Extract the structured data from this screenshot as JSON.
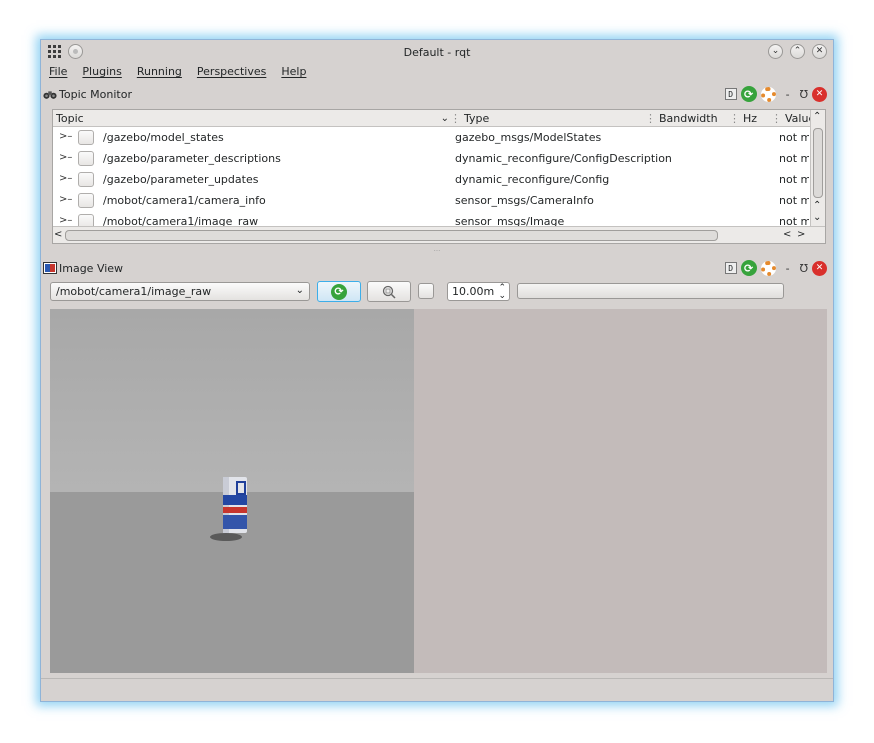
{
  "window": {
    "title": "Default - rqt"
  },
  "menubar": {
    "items": [
      "File",
      "Plugins",
      "Running",
      "Perspectives",
      "Help"
    ]
  },
  "topic_monitor": {
    "title": "Topic Monitor",
    "dock_buttons": {
      "debug_label": "D",
      "minimize_label": "-",
      "float_label": "Ʊ"
    },
    "columns": [
      "Topic",
      "Type",
      "Bandwidth",
      "Hz",
      "Value"
    ],
    "rows": [
      {
        "topic": "/gazebo/model_states",
        "type": "gazebo_msgs/ModelStates",
        "value": "not mo"
      },
      {
        "topic": "/gazebo/parameter_descriptions",
        "type": "dynamic_reconfigure/ConfigDescription",
        "value": "not mo"
      },
      {
        "topic": "/gazebo/parameter_updates",
        "type": "dynamic_reconfigure/Config",
        "value": "not mo"
      },
      {
        "topic": "/mobot/camera1/camera_info",
        "type": "sensor_msgs/CameraInfo",
        "value": "not mo"
      },
      {
        "topic": "/mobot/camera1/image_raw",
        "type": "sensor_msgs/Image",
        "value": "not mo"
      }
    ]
  },
  "image_view": {
    "title": "Image View",
    "dock_buttons": {
      "debug_label": "D",
      "minimize_label": "-",
      "float_label": "Ʊ"
    },
    "topic_select": "/mobot/camera1/image_raw",
    "max_range": "10.00m"
  },
  "colors": {
    "window_bg": "#d6d2d0",
    "accent": "#3daee9",
    "right_panel": "#c3bbba",
    "close_red": "#d9302c",
    "reload_green": "#37a33c"
  }
}
